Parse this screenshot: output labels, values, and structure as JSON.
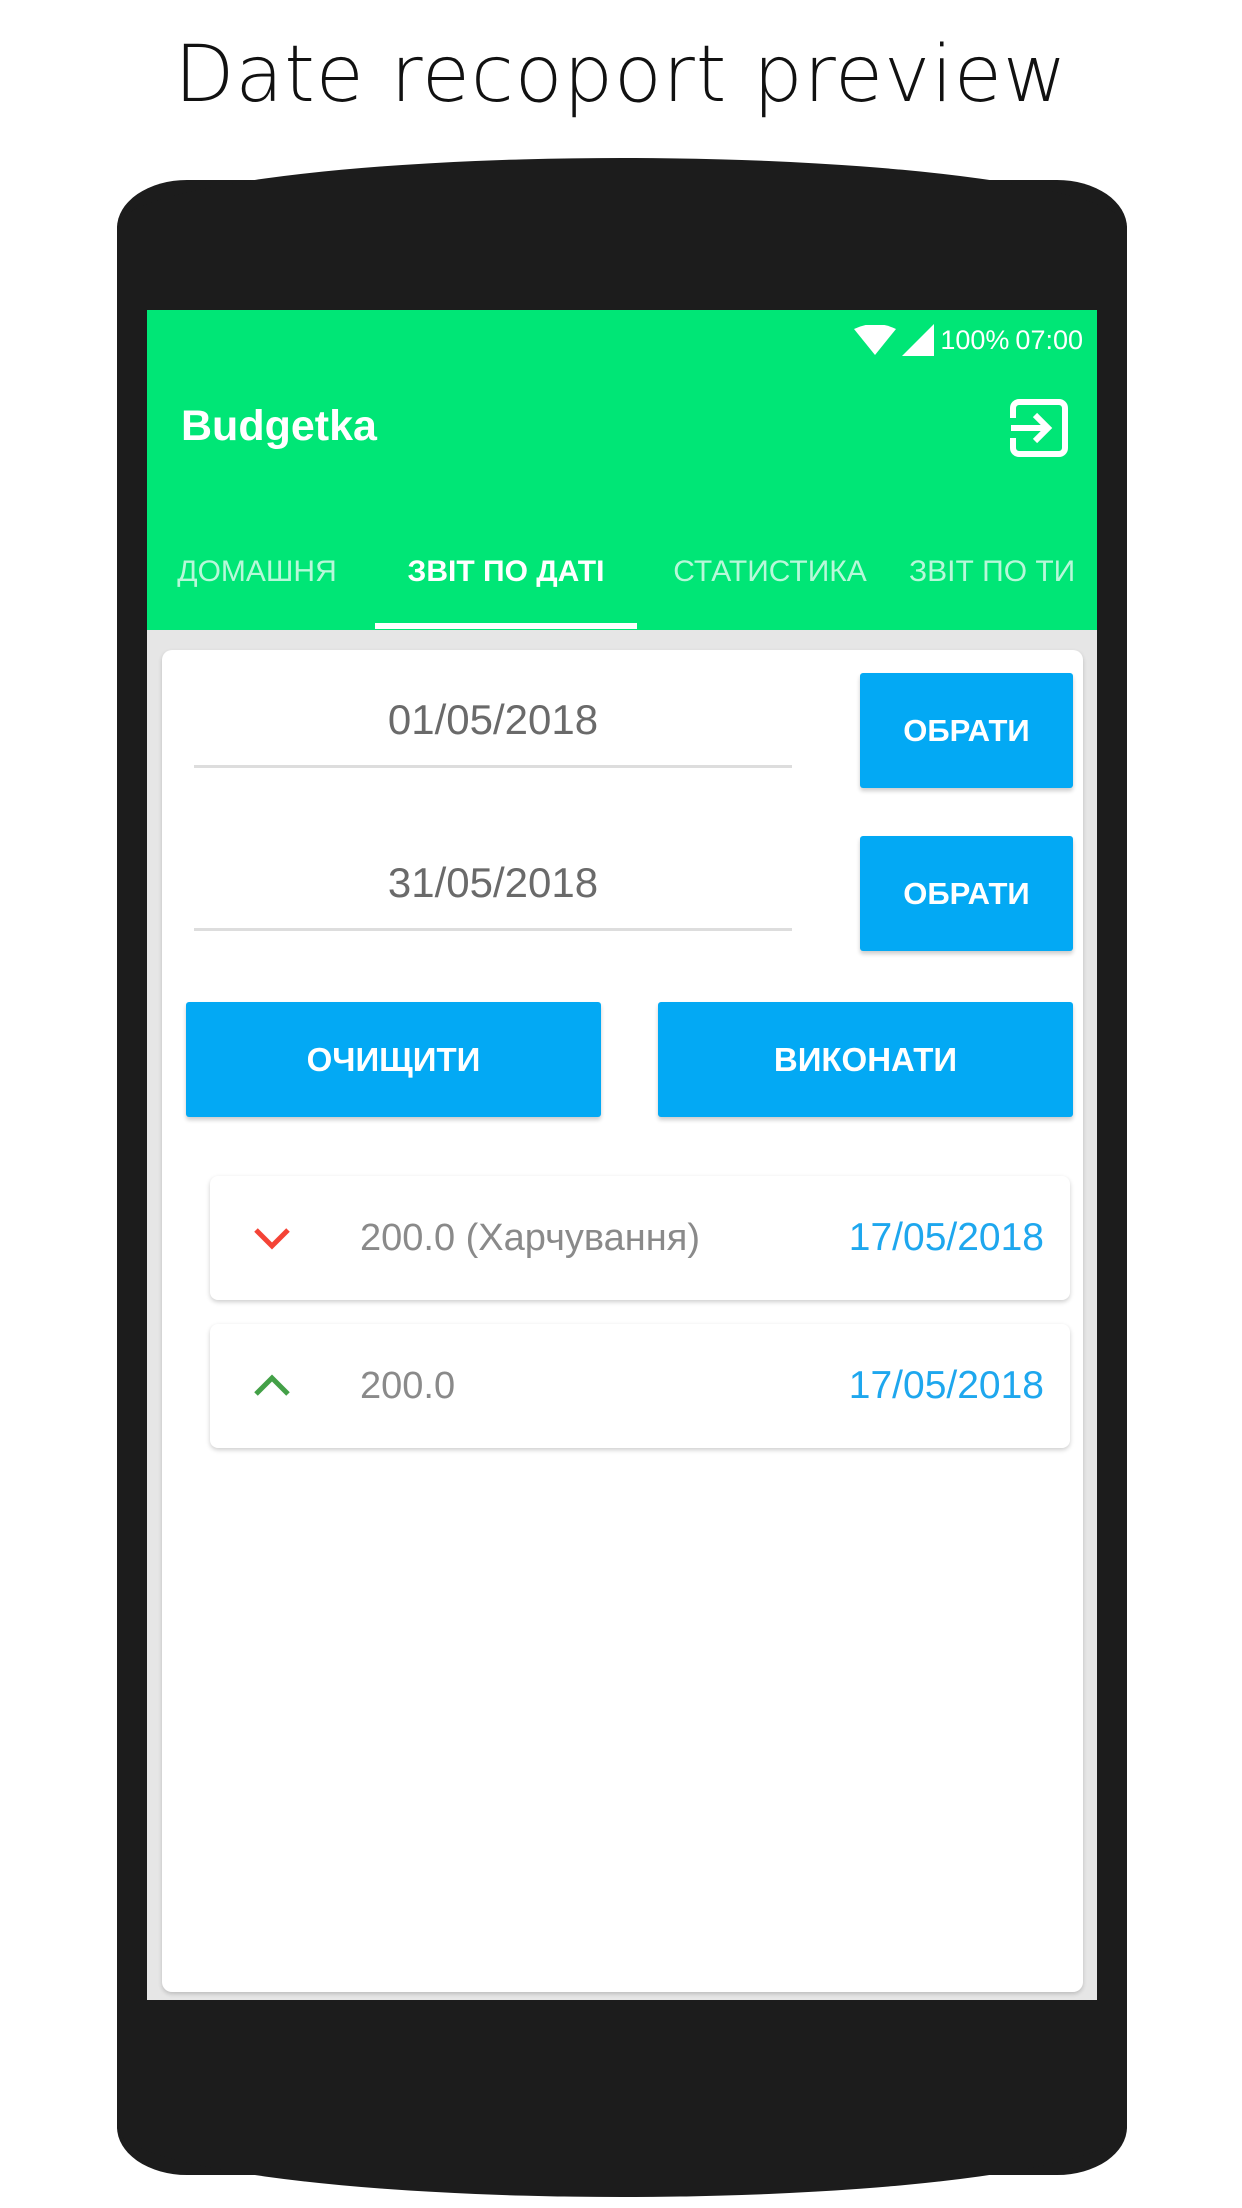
{
  "page": {
    "title": "Date recoport preview"
  },
  "status_bar": {
    "battery": "100%",
    "time": "07:00",
    "icons": [
      "wifi-icon",
      "signal-icon"
    ]
  },
  "app_bar": {
    "title": "Budgetka",
    "action_icon": "exit-icon",
    "color": "#00e676"
  },
  "tabs": [
    {
      "label": "ДОМАШНЯ",
      "active": false
    },
    {
      "label": "ЗВІТ ПО ДАТІ",
      "active": true
    },
    {
      "label": "СТАТИСТИКА",
      "active": false
    },
    {
      "label": "ЗВІТ ПО ТИ",
      "active": false
    }
  ],
  "filters": {
    "date_from": "01/05/2018",
    "date_to": "31/05/2018",
    "pick_label_1": "ОБРАТИ",
    "pick_label_2": "ОБРАТИ",
    "clear_label": "ОЧИЩИТИ",
    "run_label": "ВИКОНАТИ",
    "button_color": "#03a9f4"
  },
  "transactions": [
    {
      "direction": "expense",
      "icon": "chevron-down-icon",
      "amount": "200.0 (Харчування)",
      "date": "17/05/2018",
      "icon_color": "#f44336"
    },
    {
      "direction": "income",
      "icon": "chevron-up-icon",
      "amount": "200.0",
      "date": "17/05/2018",
      "icon_color": "#43a047"
    }
  ]
}
